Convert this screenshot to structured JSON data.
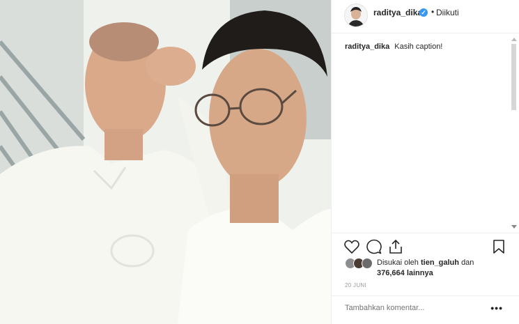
{
  "post": {
    "image_alt": "photo-of-two-men",
    "username": "raditya_dika",
    "separator": "•",
    "follow_status": "Diikuti",
    "caption_user": "raditya_dika",
    "caption_text": "Kasih caption!",
    "liked_by_prefix": "Disukai oleh",
    "liked_by_user": "tien_galuh",
    "liked_by_conj": "dan",
    "liked_by_count": "376,664 lainnya",
    "date": "20 JUNI",
    "comment_placeholder": "Tambahkan komentar...",
    "more_label": "•••"
  },
  "colors": {
    "verified": "#3897f0",
    "border": "#efefef",
    "text": "#262626",
    "muted": "#999999"
  }
}
